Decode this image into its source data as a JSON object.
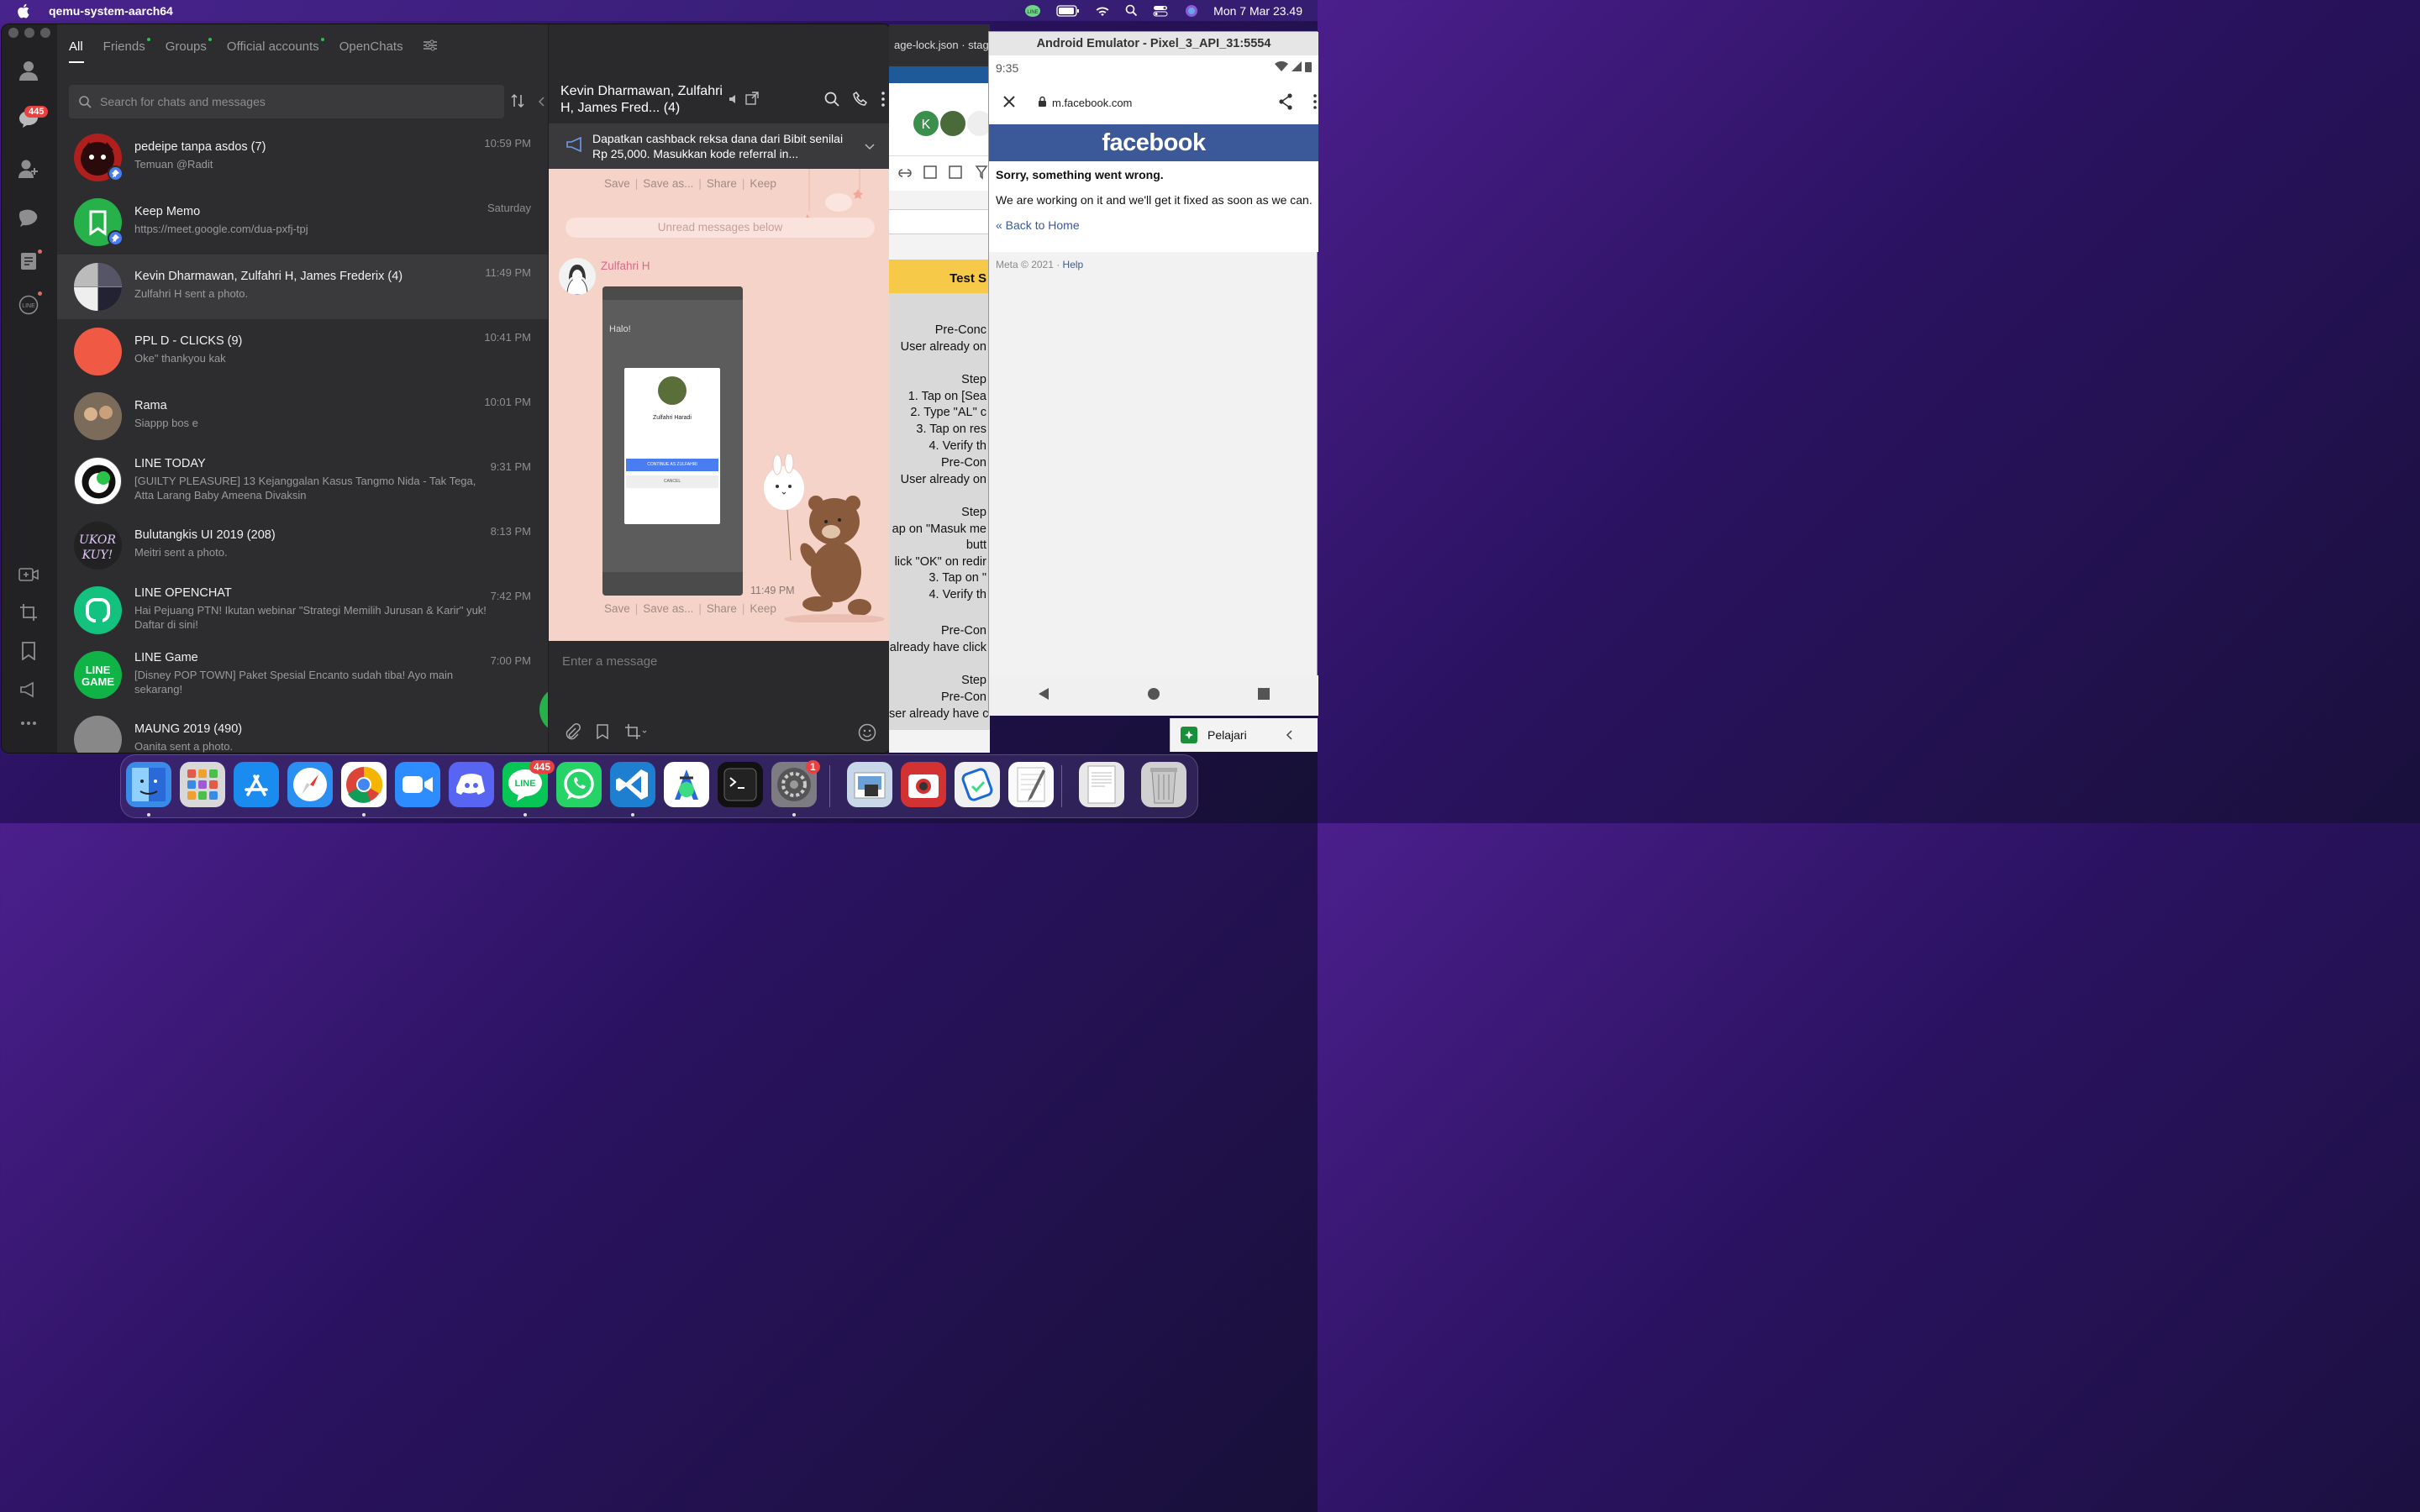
{
  "menubar": {
    "app_name": "qemu-system-aarch64",
    "clock": "Mon 7 Mar  23.49"
  },
  "line": {
    "rail": {
      "chats_badge": "445"
    },
    "tabs": [
      {
        "label": "All"
      },
      {
        "label": "Friends"
      },
      {
        "label": "Groups"
      },
      {
        "label": "Official accounts"
      },
      {
        "label": "OpenChats"
      }
    ],
    "search": {
      "placeholder": "Search for chats and messages"
    },
    "chats": [
      {
        "name": "pedeipe tanpa asdos (7)",
        "message": "Temuan @Radit",
        "time": "10:59 PM",
        "avatar_color": "#b01e1e"
      },
      {
        "name": "Keep Memo",
        "message": "https://meet.google.com/dua-pxfj-tpj",
        "time": "Saturday",
        "avatar_color": "#27b14a"
      },
      {
        "name": "Kevin Dharmawan, Zulfahri H, James Frederix (4)",
        "message": "Zulfahri H sent a photo.",
        "time": "11:49 PM",
        "avatar_color": "#8a8a8a"
      },
      {
        "name": "PPL D - CLICKS (9)",
        "message": "Oke\" thankyou kak",
        "time": "10:41 PM",
        "avatar_color": "#f05a45"
      },
      {
        "name": "Rama",
        "message": "Siappp bos e",
        "time": "10:01 PM",
        "avatar_color": "#6b5a4a"
      },
      {
        "name": "LINE TODAY",
        "message": "[GUILTY PLEASURE] 13 Kejanggalan Kasus Tangmo Nida - Tak Tega, Atta Larang Baby Ameena Divaksin",
        "time": "9:31 PM",
        "avatar_color": "#ffffff"
      },
      {
        "name": "Bulutangkis UI 2019 (208)",
        "message": "Meitri sent a photo.",
        "time": "8:13 PM",
        "avatar_color": "#222222"
      },
      {
        "name": "LINE OPENCHAT",
        "message": "Hai Pejuang PTN! Ikutan webinar \"Strategi Memilih Jurusan & Karir\" yuk! Daftar di sini!",
        "time": "7:42 PM",
        "avatar_color": "#12c27e"
      },
      {
        "name": "LINE Game",
        "message": "[Disney POP TOWN] Paket Spesial Encanto sudah tiba! Ayo main sekarang!",
        "time": "7:00 PM",
        "avatar_color": "#10b345"
      },
      {
        "name": "MAUNG 2019 (490)",
        "message": "Oanita sent a photo.",
        "time": "",
        "avatar_color": "#888888"
      }
    ],
    "game_avatar_text": "LINE GAME",
    "bulu_avatar_text": "UKOR KUY!",
    "conversation": {
      "title": "Kevin Dharmawan, Zulfahri H, James Fred... (4)",
      "notice": "Dapatkan cashback reksa dana dari Bibit senilai Rp 25,000. Masukkan kode referral in...",
      "actions": [
        "Save",
        "Save as...",
        "Share",
        "Keep"
      ],
      "unread": "Unread messages below",
      "sender": "Zulfahri H",
      "photo_time": "11:49 PM",
      "photo": {
        "greeting": "Halo!",
        "name": "Zulfahri Haradi",
        "continue": "CONTINUE AS ZULFAHRI",
        "cancel": "CANCEL"
      },
      "input_placeholder": "Enter a message"
    }
  },
  "sheet": {
    "tab": "age-lock.json · stag",
    "header": "Test S",
    "rows": [
      "Pre-Conc",
      "User already on",
      "Step",
      "1. Tap on [Sea",
      "2. Type \"AL\" c",
      "3. Tap on res",
      "4. Verify th",
      "Pre-Con",
      "User already on",
      "Step",
      "ap on \"Masuk me",
      "butt",
      "lick \"OK\" on redir",
      "3. Tap on \"",
      "4. Verify th",
      "Pre-Con",
      "already have click",
      "Step",
      "Pre-Con",
      "ser already have c"
    ],
    "pelajari": "Pelajari"
  },
  "emulator": {
    "window_title": "Android Emulator - Pixel_3_API_31:5554",
    "time": "9:35",
    "url": "m.facebook.com",
    "brand": "facebook",
    "error_title": "Sorry, something went wrong.",
    "error_body": "We are working on it and we'll get it fixed as soon as we can.",
    "back_link": "« Back to Home",
    "meta": "Meta © 2021 · ",
    "help": "Help"
  },
  "dock": {
    "line_badge": "445",
    "settings_badge": "1",
    "apps": [
      "Finder",
      "Launchpad",
      "App Store",
      "Safari",
      "Chrome",
      "Zoom",
      "Discord",
      "LINE",
      "WhatsApp",
      "VS Code",
      "Android Studio",
      "Terminal",
      "System Preferences",
      "Preview",
      "Photo Booth",
      "Xcode Helper",
      "TextEdit",
      "Document",
      "Trash"
    ]
  }
}
